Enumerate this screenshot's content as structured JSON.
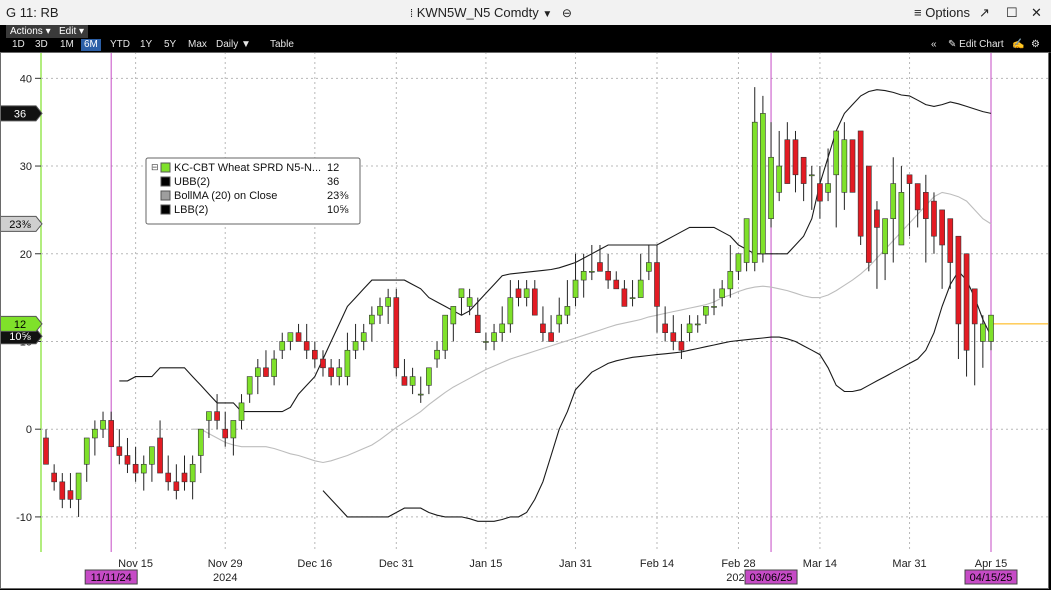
{
  "window": {
    "left_title": "G 11: RB",
    "center_title": "KWN5W_N5 Comdty",
    "options_label": "Options"
  },
  "menus": {
    "actions": "Actions",
    "edit": "Edit"
  },
  "toolbar": {
    "ranges": [
      "1D",
      "3D",
      "1M",
      "6M",
      "YTD",
      "1Y",
      "5Y",
      "Max"
    ],
    "active_range": "6M",
    "frequency": "Daily",
    "table": "Table",
    "edit_chart": "Edit Chart"
  },
  "colors": {
    "up": "#7fe12a",
    "down": "#e31b23",
    "band": "#1a1a1a",
    "ma": "#bdbdbd",
    "marker": "#c64bc6",
    "last": "#ffb000"
  },
  "chart_data": {
    "type": "candlestick",
    "xlabel": "",
    "ylabel": "",
    "ylim": [
      -14,
      43
    ],
    "y_ticks": [
      -10,
      0,
      10,
      20,
      30,
      40
    ],
    "grid": true,
    "x_tick_labels": [
      "Nov 15",
      "Nov 29",
      "Dec 16",
      "Dec 31",
      "Jan 15",
      "Jan 31",
      "Feb 14",
      "Feb 28",
      "Mar 14",
      "Mar 31",
      "Apr 15"
    ],
    "x_tick_index": [
      11,
      22,
      33,
      43,
      54,
      65,
      75,
      85,
      95,
      106,
      116
    ],
    "year_labels": [
      {
        "text": "2024",
        "index": 22
      },
      {
        "text": "2025",
        "index": 85
      }
    ],
    "date_markers": [
      {
        "text": "11/11/24",
        "index": 8
      },
      {
        "text": "03/06/25",
        "index": 89
      },
      {
        "text": "04/15/25",
        "index": 116
      }
    ],
    "legend": [
      {
        "label": "KC-CBT Wheat SPRD N5-N...",
        "value": "12",
        "color": "#7fe12a"
      },
      {
        "label": "UBB(2)",
        "value": "36",
        "color": "#000000"
      },
      {
        "label": "BollMA (20)  on Close",
        "value": "23⅜",
        "color": "#9e9e9e"
      },
      {
        "label": "LBB(2)",
        "value": "10⅝",
        "color": "#000000"
      }
    ],
    "legend_position": "upper-left",
    "y_tags": [
      {
        "text": "36",
        "value": 36,
        "style": "dark"
      },
      {
        "text": "23⅜",
        "value": 23.4,
        "style": "gray"
      },
      {
        "text": "10⅝",
        "value": 10.6,
        "style": "dark"
      },
      {
        "text": "12",
        "value": 12,
        "style": "green"
      }
    ],
    "last_price": 12,
    "candles": {
      "open": [
        -1,
        -5,
        -6,
        -7,
        -8,
        -4,
        -1,
        0,
        1,
        -2,
        -3,
        -4,
        -5,
        -4,
        -1,
        -5,
        -6,
        -5,
        -6,
        -3,
        1,
        2,
        0,
        -1,
        1,
        4,
        6,
        7,
        6,
        9,
        10,
        11,
        10,
        9,
        8,
        7,
        6,
        6,
        9,
        10,
        12,
        13,
        14,
        15,
        6,
        5,
        4,
        5,
        8,
        9,
        12,
        15,
        14,
        13,
        10,
        10,
        11,
        12,
        16,
        15,
        16,
        12,
        11,
        12,
        13,
        15,
        17,
        18,
        19,
        18,
        17,
        16,
        15,
        15,
        18,
        19,
        12,
        11,
        10,
        11,
        12,
        13,
        14,
        15,
        16,
        18,
        19,
        19,
        20,
        24,
        27,
        33,
        33,
        31,
        29,
        28,
        27,
        29,
        27,
        33,
        34,
        30,
        25,
        20,
        24,
        21,
        29,
        28,
        27,
        26,
        25,
        24,
        22,
        20,
        16,
        10,
        10,
        12,
        12
      ],
      "high": [
        0,
        -4,
        -5,
        -5,
        -6,
        -1,
        1,
        2,
        2,
        0,
        -1,
        -2,
        -3,
        -2,
        1,
        -3,
        -4,
        -3,
        -3,
        -1,
        2,
        4,
        2,
        1,
        4,
        6,
        8,
        9,
        9,
        11,
        11,
        12,
        12,
        10,
        9,
        8,
        8,
        11,
        12,
        12,
        14,
        15,
        16,
        16,
        8,
        7,
        6,
        7,
        10,
        13,
        14,
        16,
        16,
        15,
        11,
        12,
        14,
        17,
        17,
        17,
        17,
        14,
        13,
        15,
        17,
        20,
        20,
        21,
        21,
        20,
        18,
        17,
        17,
        20,
        21,
        21,
        14,
        13,
        12,
        13,
        13,
        14,
        16,
        17,
        21,
        20,
        23,
        39,
        38,
        35,
        34,
        35,
        34,
        31,
        30,
        30,
        32,
        34,
        35,
        32,
        28,
        22,
        26,
        24,
        31,
        30,
        29,
        28,
        29,
        27,
        25,
        22,
        18,
        12,
        12,
        13,
        12
      ],
      "low": [
        -3,
        -7,
        -9,
        -9,
        -10,
        -6,
        -3,
        -1,
        -1,
        -4,
        -5,
        -6,
        -7,
        -6,
        -3,
        -7,
        -8,
        -7,
        -8,
        -5,
        -1,
        0,
        -2,
        -3,
        0,
        3,
        4,
        6,
        5,
        8,
        9,
        10,
        8,
        7,
        6,
        5,
        5,
        5,
        8,
        9,
        10,
        12,
        12,
        6,
        5,
        4,
        3,
        4,
        7,
        8,
        10,
        13,
        13,
        11,
        9,
        9,
        10,
        11,
        14,
        14,
        13,
        10,
        10,
        11,
        12,
        14,
        15,
        17,
        18,
        16,
        16,
        14,
        14,
        15,
        17,
        11,
        10,
        9,
        8,
        10,
        11,
        12,
        13,
        14,
        15,
        17,
        18,
        18,
        19,
        23,
        26,
        28,
        27,
        26,
        25,
        24,
        26,
        23,
        25,
        27,
        21,
        18,
        16,
        17,
        19,
        23,
        22,
        23,
        19,
        20,
        16,
        16,
        8,
        6,
        5,
        7,
        9
      ],
      "close": [
        -4,
        -6,
        -8,
        -8,
        -5,
        -1,
        0,
        1,
        -2,
        -3,
        -4,
        -5,
        -4,
        -2,
        -5,
        -6,
        -7,
        -6,
        -4,
        0,
        2,
        1,
        -1,
        1,
        3,
        6,
        7,
        6,
        8,
        10,
        11,
        10,
        9,
        8,
        7,
        6,
        7,
        9,
        10,
        11,
        13,
        14,
        15,
        7,
        5,
        6,
        4,
        7,
        9,
        13,
        14,
        16,
        15,
        11,
        10,
        11,
        12,
        15,
        15,
        16,
        13,
        11,
        10,
        13,
        14,
        17,
        18,
        18,
        18,
        17,
        16,
        14,
        15,
        17,
        19,
        14,
        11,
        10,
        9,
        12,
        12,
        14,
        14,
        16,
        18,
        20,
        24,
        35,
        36,
        31,
        30,
        28,
        29,
        28,
        29,
        26,
        28,
        34,
        33,
        27,
        22,
        19,
        23,
        24,
        28,
        27,
        28,
        25,
        24,
        22,
        21,
        19,
        12,
        9,
        12,
        12,
        13
      ]
    },
    "upper_band": [
      5.5,
      5.5,
      6,
      6,
      6,
      7,
      7,
      7,
      7,
      6,
      5,
      4,
      3,
      3,
      3,
      2,
      2,
      2,
      2,
      2,
      2,
      2.5,
      4,
      5,
      6,
      8,
      10,
      12,
      14,
      15,
      16,
      17,
      17,
      17,
      17,
      17,
      16.5,
      16,
      15,
      14.5,
      14,
      13.5,
      13,
      13.5,
      14.5,
      15.5,
      16.5,
      17.5,
      17.7,
      17.8,
      17.9,
      18,
      18.1,
      18.2,
      18.4,
      18.7,
      19,
      19.5,
      20,
      20.5,
      21,
      21,
      21,
      21,
      21,
      21,
      21,
      21.5,
      22,
      22.5,
      23,
      23,
      23,
      23,
      22.5,
      22,
      21,
      20.5,
      20,
      20,
      20,
      20,
      20,
      21,
      22,
      24,
      28,
      31,
      34,
      36,
      37,
      38,
      38.5,
      38.7,
      38.6,
      38.4,
      38.1,
      38,
      37.5,
      37,
      36.8,
      37,
      37.3,
      37.1,
      36.8,
      36.5,
      36.2,
      36
    ],
    "ma": [
      0,
      0,
      -0.5,
      -1,
      -1.5,
      -1.8,
      -2,
      -2,
      -2,
      -2,
      -2.2,
      -2.5,
      -2.8,
      -3,
      -3.3,
      -3.6,
      -3.8,
      -3.6,
      -3.3,
      -3,
      -2.6,
      -2.2,
      -1.8,
      -1.2,
      -0.5,
      0.2,
      0.8,
      1.4,
      2,
      2.8,
      3.5,
      4.2,
      4.8,
      5.3,
      5.8,
      6.3,
      6.8,
      7.2,
      7.6,
      8,
      8.3,
      8.6,
      8.9,
      9.2,
      9.5,
      9.8,
      10.1,
      10.4,
      10.7,
      11,
      11.3,
      11.6,
      11.9,
      12.1,
      12.3,
      12.5,
      12.8,
      13,
      13.2,
      13.4,
      13.6,
      13.8,
      14,
      14.2,
      14.5,
      15,
      15.3,
      15.7,
      16,
      16.2,
      16.3,
      16.2,
      16,
      15.8,
      15.5,
      15.2,
      15,
      15,
      15.3,
      15.8,
      16.4,
      17,
      17.7,
      18.5,
      19.5,
      20.5,
      21.5,
      22.5,
      23.5,
      24.5,
      25.5,
      26.5,
      27,
      26.8,
      26.5,
      26,
      25,
      24,
      23.4
    ],
    "lower_band": [
      -7,
      -8,
      -9,
      -10,
      -10,
      -10,
      -10,
      -10,
      -10,
      -9.5,
      -9,
      -9,
      -9,
      -9.5,
      -9.8,
      -10,
      -10,
      -10,
      -10.2,
      -10.5,
      -10.5,
      -10.5,
      -10.3,
      -10,
      -10,
      -9.5,
      -8,
      -6,
      -3,
      0,
      2,
      4.5,
      5.5,
      6.5,
      7,
      7.5,
      7.8,
      8,
      8.2,
      8.3,
      8.4,
      8.5,
      8.6,
      8.7,
      8.8,
      9,
      9.2,
      9.4,
      9.6,
      9.8,
      10,
      10.1,
      10.2,
      10.3,
      10.4,
      10.5,
      10.5,
      10.3,
      10,
      9.5,
      9,
      8.5,
      7,
      5,
      4.3,
      4.3,
      4.5,
      5,
      5.5,
      6,
      6.5,
      7,
      7.5,
      8,
      9,
      11,
      14,
      16.5,
      18,
      17,
      15,
      12.5,
      10.6
    ]
  }
}
